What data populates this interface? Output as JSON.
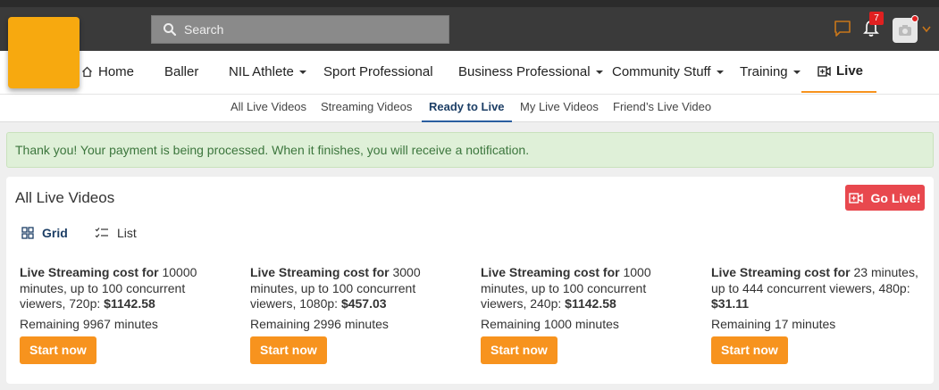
{
  "header": {
    "search_placeholder": "Search",
    "notification_count": "7",
    "accent_color": "#f7931e"
  },
  "nav": {
    "items": [
      {
        "label": "Home",
        "icon": "home-icon"
      },
      {
        "label": "Baller"
      },
      {
        "label": "NIL Athlete",
        "dropdown": true
      },
      {
        "label": "Sport Professional"
      },
      {
        "label": "Business Professional",
        "dropdown": true
      },
      {
        "label": "Community Stuff",
        "dropdown": true
      },
      {
        "label": "Training",
        "dropdown": true
      },
      {
        "label": "Live",
        "icon": "video-plus-icon",
        "active": true
      }
    ]
  },
  "subnav": {
    "items": [
      {
        "label": "All Live Videos"
      },
      {
        "label": "Streaming Videos"
      },
      {
        "label": "Ready to Live",
        "active": true
      },
      {
        "label": "My Live Videos"
      },
      {
        "label": "Friend’s Live Video"
      }
    ]
  },
  "alert": {
    "message": "Thank you! Your payment is being processed. When it finishes, you will receive a notification."
  },
  "panel": {
    "title": "All Live Videos",
    "go_live_label": "Go Live!",
    "view_grid_label": "Grid",
    "view_list_label": "List",
    "cards": [
      {
        "heading": "Live Streaming cost for",
        "details": "10000 minutes, up to 100 concurrent viewers, 720p:",
        "price": "$1142.58",
        "remaining": "Remaining 9967 minutes",
        "button": "Start now"
      },
      {
        "heading": "Live Streaming cost for",
        "details": "3000 minutes, up to 100 concurrent viewers, 1080p:",
        "price": "$457.03",
        "remaining": "Remaining 2996 minutes",
        "button": "Start now"
      },
      {
        "heading": "Live Streaming cost for",
        "details": "1000 minutes, up to 100 concurrent viewers, 240p:",
        "price": "$1142.58",
        "remaining": "Remaining 1000 minutes",
        "button": "Start now"
      },
      {
        "heading": "Live Streaming cost for",
        "details": "23 minutes, up to 444 concurrent viewers, 480p:",
        "price": "$31.11",
        "remaining": "Remaining 17 minutes",
        "button": "Start now"
      }
    ]
  }
}
